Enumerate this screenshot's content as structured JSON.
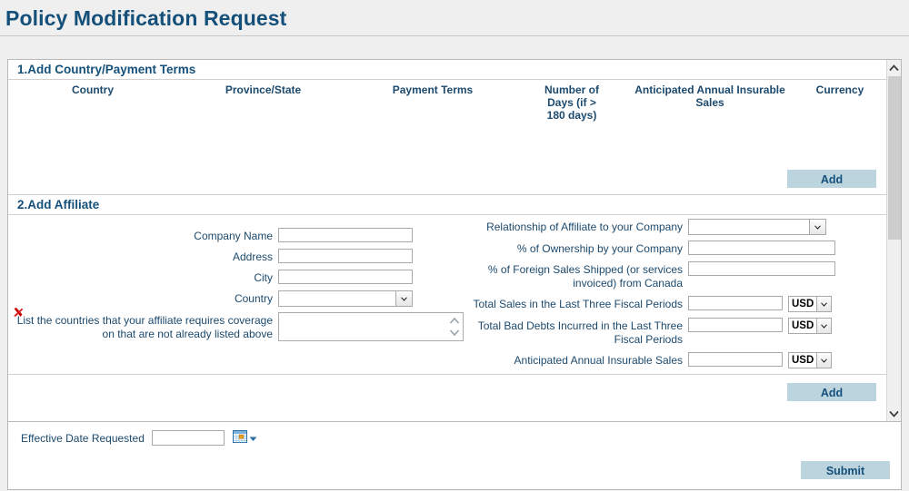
{
  "page": {
    "title": "Policy Modification Request"
  },
  "section1": {
    "heading": "1.Add Country/Payment Terms",
    "columns": [
      "Country",
      "Province/State",
      "Payment Terms",
      "Number of Days (if > 180 days)",
      "Anticipated Annual Insurable Sales",
      "Currency"
    ],
    "column_lines": {
      "days_l1": "Number of",
      "days_l2": "Days (if >",
      "days_l3": "180 days)",
      "sales_l1": "Anticipated Annual Insurable",
      "sales_l2": "Sales"
    },
    "rows": [],
    "add_label": "Add"
  },
  "section2": {
    "heading": "2.Add Affiliate",
    "delete_icon": "red-x-icon",
    "left_fields": [
      {
        "label": "Company Name",
        "type": "text",
        "value": ""
      },
      {
        "label": "Address",
        "type": "text",
        "value": ""
      },
      {
        "label": "City",
        "type": "text",
        "value": ""
      },
      {
        "label": "Country",
        "type": "select",
        "value": ""
      },
      {
        "label": "List the countries that your affiliate requires coverage on that are not already listed above",
        "type": "textarea",
        "value": ""
      }
    ],
    "right_fields": [
      {
        "label": "Relationship of Affiliate to your Company",
        "type": "select",
        "value": ""
      },
      {
        "label": "% of Ownership by your Company",
        "type": "text",
        "value": ""
      },
      {
        "label": "% of Foreign Sales Shipped (or services invoiced) from Canada",
        "type": "text",
        "value": ""
      },
      {
        "label": "Total Sales in the Last Three Fiscal Periods",
        "type": "money",
        "value": "",
        "currency": "USD"
      },
      {
        "label": "Total Bad Debts Incurred in the Last Three Fiscal Periods",
        "type": "money",
        "value": "",
        "currency": "USD"
      },
      {
        "label": "Anticipated Annual Insurable Sales",
        "type": "money",
        "value": "",
        "currency": "USD"
      }
    ],
    "add_label": "Add"
  },
  "footer": {
    "effective_date_label": "Effective Date Requested",
    "effective_date_value": "",
    "calendar_icon": "calendar-icon",
    "submit_label": "Submit"
  },
  "scrollbar": {
    "up_icon": "chevron-up-icon",
    "down_icon": "chevron-down-icon"
  },
  "colors": {
    "title": "#15507a",
    "label": "#1c4a6e",
    "button_bg": "#bcd4de",
    "page_bg": "#efefef",
    "delete": "#cc0000"
  }
}
